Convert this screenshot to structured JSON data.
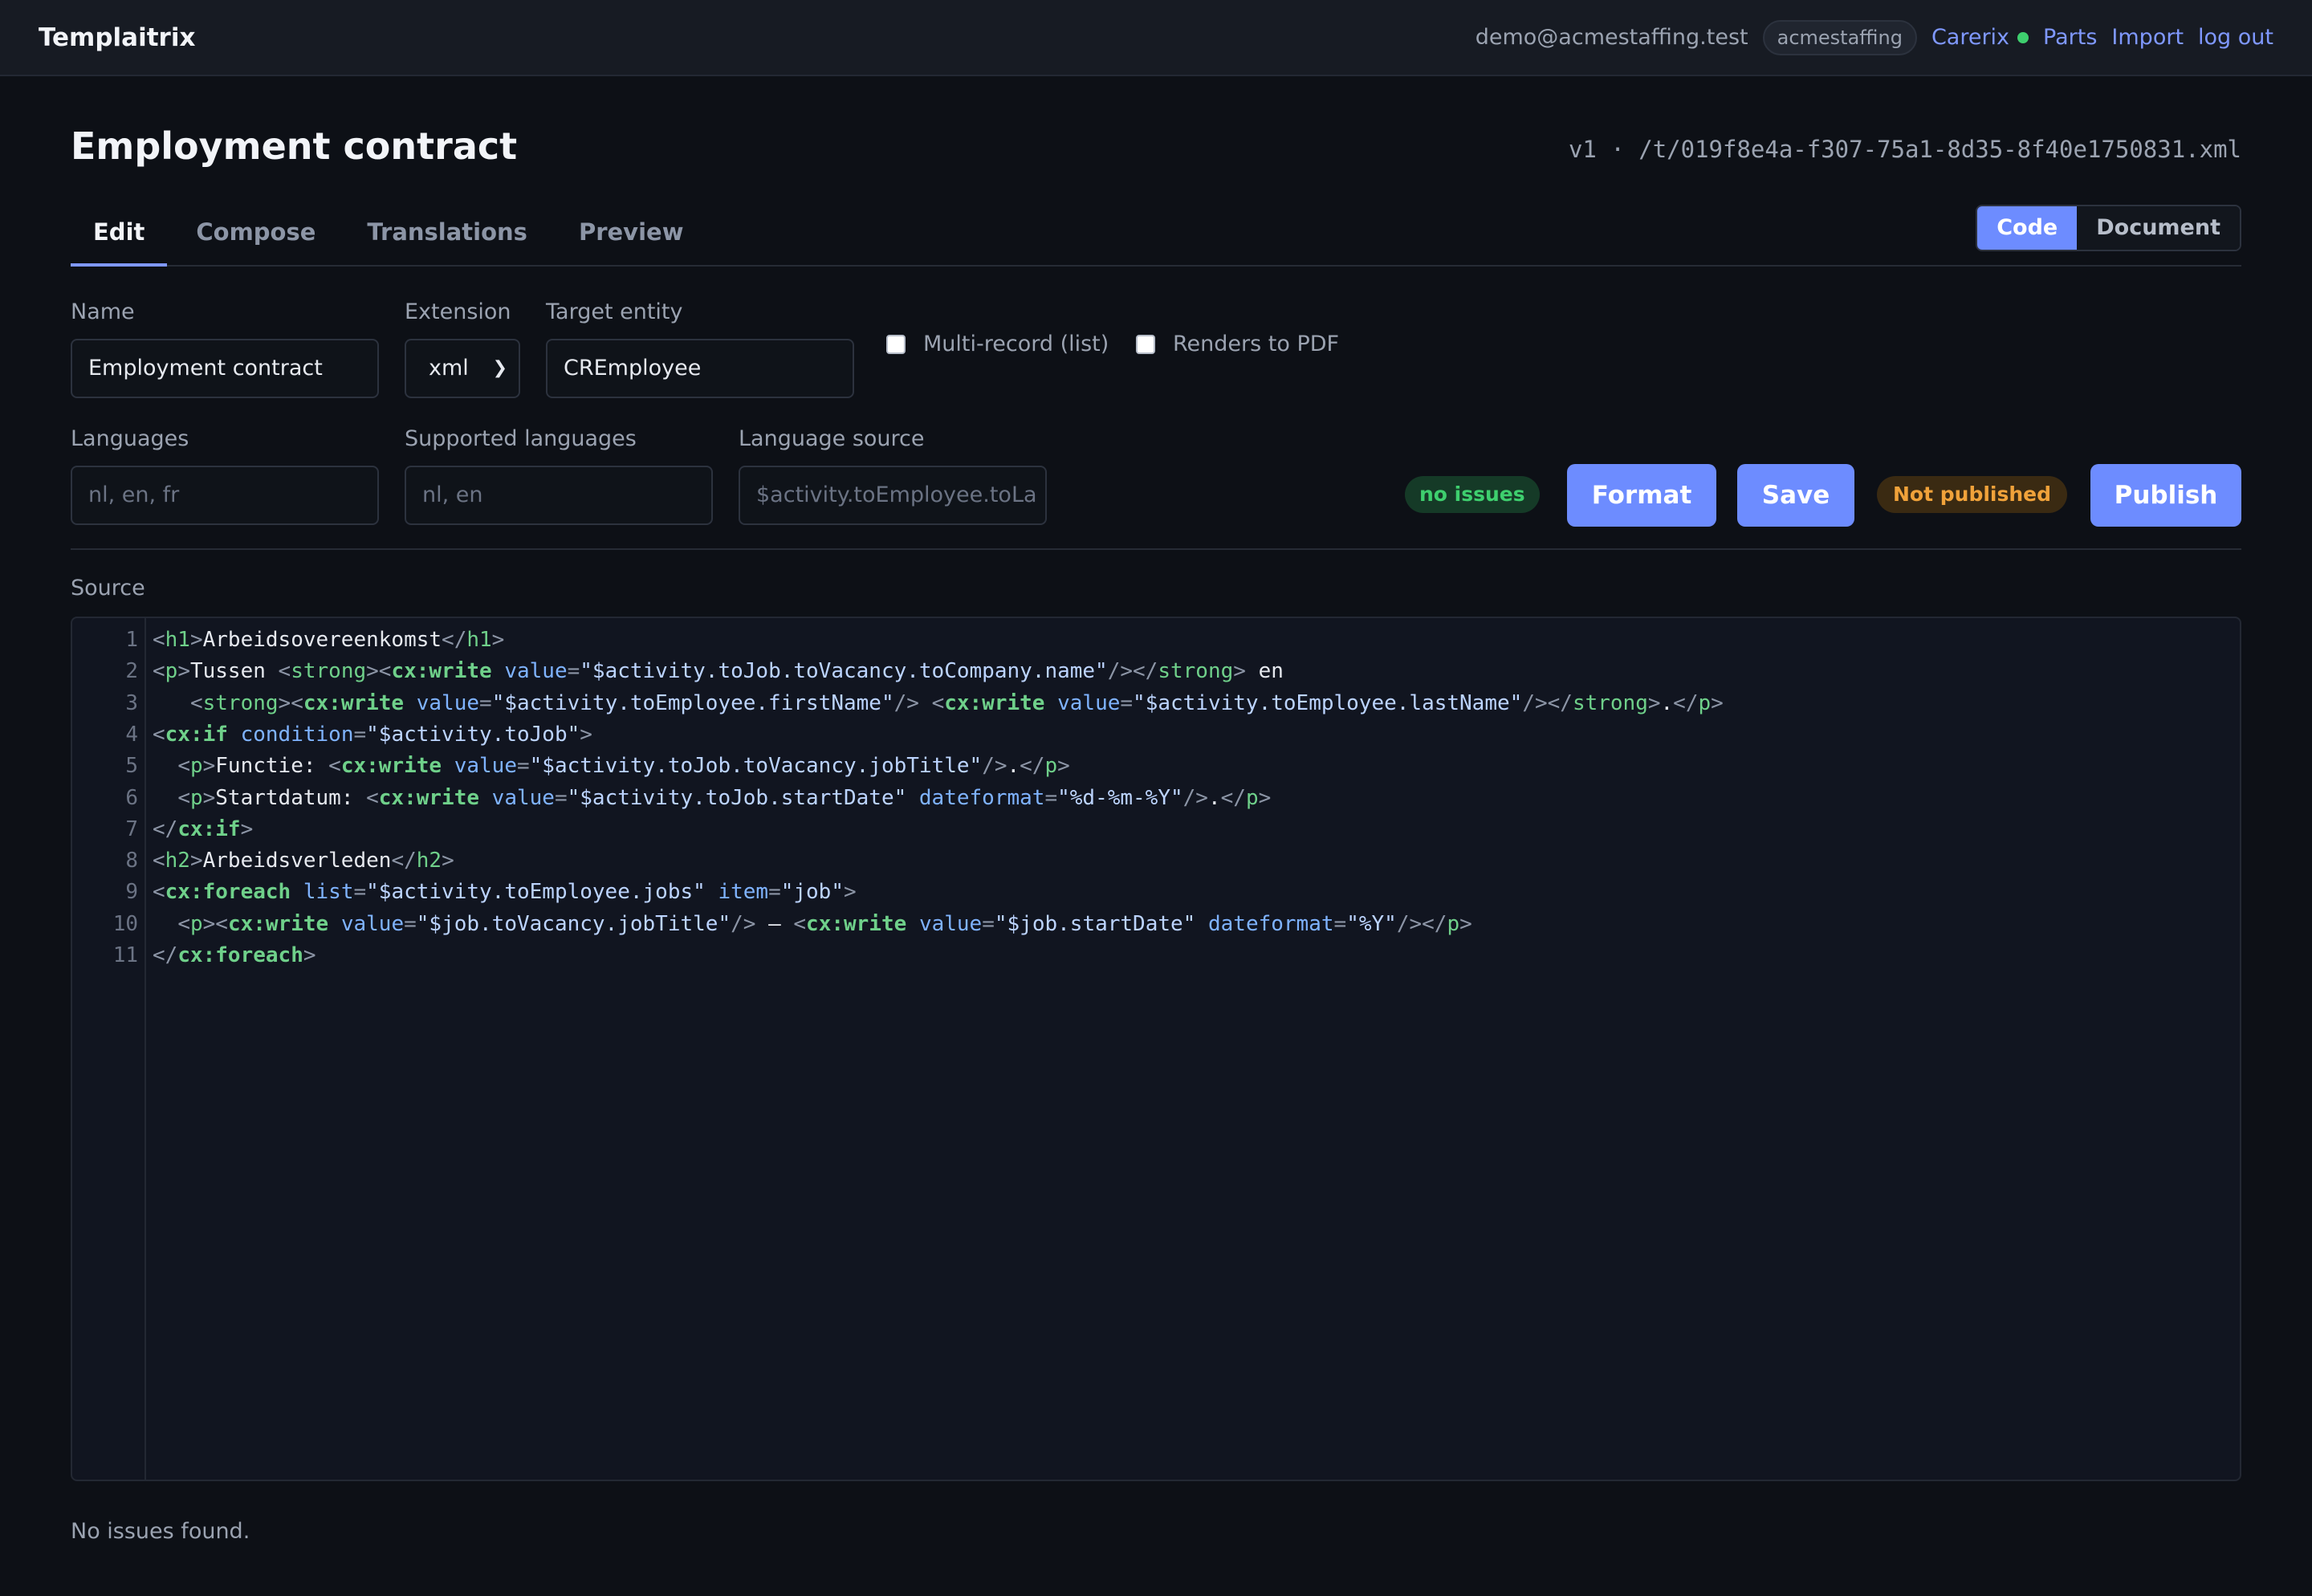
{
  "app": {
    "brand": "Templaitrix",
    "user_email": "demo@acmestaffing.test",
    "org": "acmestaffing",
    "nav": {
      "carerix": "Carerix",
      "parts": "Parts",
      "import": "Import",
      "logout": "log out"
    },
    "carerix_status_color": "#3ecf6e"
  },
  "page": {
    "title": "Employment contract",
    "meta": "v1 · /t/019f8e4a-f307-75a1-8d35-8f40e1750831.xml"
  },
  "tabs": [
    "Edit",
    "Compose",
    "Translations",
    "Preview"
  ],
  "active_tab": "Edit",
  "view_toggle": {
    "code": "Code",
    "document": "Document",
    "active": "Code"
  },
  "form": {
    "name": {
      "label": "Name",
      "value": "Employment contract"
    },
    "extension": {
      "label": "Extension",
      "value": "xml"
    },
    "target_entity": {
      "label": "Target entity",
      "value": "CREmployee"
    },
    "multi_record": {
      "label": "Multi-record (list)",
      "checked": false
    },
    "renders_pdf": {
      "label": "Renders to PDF",
      "checked": false
    },
    "languages": {
      "label": "Languages",
      "placeholder": "nl, en, fr"
    },
    "supported_languages": {
      "label": "Supported languages",
      "placeholder": "nl, en"
    },
    "language_source": {
      "label": "Language source",
      "placeholder": "$activity.toEmployee.toLa"
    }
  },
  "actions": {
    "issues_badge": "no issues",
    "format": "Format",
    "save": "Save",
    "publish_status": "Not published",
    "publish": "Publish"
  },
  "source": {
    "label": "Source",
    "lines": [
      [
        [
          "br",
          "<"
        ],
        [
          "tag",
          "h1"
        ],
        [
          "br",
          ">"
        ],
        [
          "txt",
          "Arbeidsovereenkomst"
        ],
        [
          "br",
          "</"
        ],
        [
          "tag",
          "h1"
        ],
        [
          "br",
          ">"
        ]
      ],
      [
        [
          "br",
          "<"
        ],
        [
          "tag",
          "p"
        ],
        [
          "br",
          ">"
        ],
        [
          "txt",
          "Tussen "
        ],
        [
          "br",
          "<"
        ],
        [
          "tag",
          "strong"
        ],
        [
          "br",
          "><"
        ],
        [
          "cx",
          "cx:write"
        ],
        [
          "txt",
          " "
        ],
        [
          "attr",
          "value"
        ],
        [
          "br",
          "="
        ],
        [
          "str",
          "\"$activity.toJob.toVacancy.toCompany.name\""
        ],
        [
          "br",
          "/></"
        ],
        [
          "tag",
          "strong"
        ],
        [
          "br",
          ">"
        ],
        [
          "txt",
          " en"
        ]
      ],
      [
        [
          "txt",
          "   "
        ],
        [
          "br",
          "<"
        ],
        [
          "tag",
          "strong"
        ],
        [
          "br",
          "><"
        ],
        [
          "cx",
          "cx:write"
        ],
        [
          "txt",
          " "
        ],
        [
          "attr",
          "value"
        ],
        [
          "br",
          "="
        ],
        [
          "str",
          "\"$activity.toEmployee.firstName\""
        ],
        [
          "br",
          "/>"
        ],
        [
          "txt",
          " "
        ],
        [
          "br",
          "<"
        ],
        [
          "cx",
          "cx:write"
        ],
        [
          "txt",
          " "
        ],
        [
          "attr",
          "value"
        ],
        [
          "br",
          "="
        ],
        [
          "str",
          "\"$activity.toEmployee.lastName\""
        ],
        [
          "br",
          "/></"
        ],
        [
          "tag",
          "strong"
        ],
        [
          "br",
          ">"
        ],
        [
          "txt",
          "."
        ],
        [
          "br",
          "</"
        ],
        [
          "tag",
          "p"
        ],
        [
          "br",
          ">"
        ]
      ],
      [
        [
          "br",
          "<"
        ],
        [
          "cx",
          "cx:if"
        ],
        [
          "txt",
          " "
        ],
        [
          "attr",
          "condition"
        ],
        [
          "br",
          "="
        ],
        [
          "str",
          "\"$activity.toJob\""
        ],
        [
          "br",
          ">"
        ]
      ],
      [
        [
          "txt",
          "  "
        ],
        [
          "br",
          "<"
        ],
        [
          "tag",
          "p"
        ],
        [
          "br",
          ">"
        ],
        [
          "txt",
          "Functie: "
        ],
        [
          "br",
          "<"
        ],
        [
          "cx",
          "cx:write"
        ],
        [
          "txt",
          " "
        ],
        [
          "attr",
          "value"
        ],
        [
          "br",
          "="
        ],
        [
          "str",
          "\"$activity.toJob.toVacancy.jobTitle\""
        ],
        [
          "br",
          "/>"
        ],
        [
          "txt",
          "."
        ],
        [
          "br",
          "</"
        ],
        [
          "tag",
          "p"
        ],
        [
          "br",
          ">"
        ]
      ],
      [
        [
          "txt",
          "  "
        ],
        [
          "br",
          "<"
        ],
        [
          "tag",
          "p"
        ],
        [
          "br",
          ">"
        ],
        [
          "txt",
          "Startdatum: "
        ],
        [
          "br",
          "<"
        ],
        [
          "cx",
          "cx:write"
        ],
        [
          "txt",
          " "
        ],
        [
          "attr",
          "value"
        ],
        [
          "br",
          "="
        ],
        [
          "str",
          "\"$activity.toJob.startDate\""
        ],
        [
          "txt",
          " "
        ],
        [
          "attr",
          "dateformat"
        ],
        [
          "br",
          "="
        ],
        [
          "str",
          "\"%d-%m-%Y\""
        ],
        [
          "br",
          "/>"
        ],
        [
          "txt",
          "."
        ],
        [
          "br",
          "</"
        ],
        [
          "tag",
          "p"
        ],
        [
          "br",
          ">"
        ]
      ],
      [
        [
          "br",
          "</"
        ],
        [
          "cx",
          "cx:if"
        ],
        [
          "br",
          ">"
        ]
      ],
      [
        [
          "br",
          "<"
        ],
        [
          "tag",
          "h2"
        ],
        [
          "br",
          ">"
        ],
        [
          "txt",
          "Arbeidsverleden"
        ],
        [
          "br",
          "</"
        ],
        [
          "tag",
          "h2"
        ],
        [
          "br",
          ">"
        ]
      ],
      [
        [
          "br",
          "<"
        ],
        [
          "cx",
          "cx:foreach"
        ],
        [
          "txt",
          " "
        ],
        [
          "attr",
          "list"
        ],
        [
          "br",
          "="
        ],
        [
          "str",
          "\"$activity.toEmployee.jobs\""
        ],
        [
          "txt",
          " "
        ],
        [
          "attr",
          "item"
        ],
        [
          "br",
          "="
        ],
        [
          "str",
          "\"job\""
        ],
        [
          "br",
          ">"
        ]
      ],
      [
        [
          "txt",
          "  "
        ],
        [
          "br",
          "<"
        ],
        [
          "tag",
          "p"
        ],
        [
          "br",
          "><"
        ],
        [
          "cx",
          "cx:write"
        ],
        [
          "txt",
          " "
        ],
        [
          "attr",
          "value"
        ],
        [
          "br",
          "="
        ],
        [
          "str",
          "\"$job.toVacancy.jobTitle\""
        ],
        [
          "br",
          "/>"
        ],
        [
          "txt",
          " – "
        ],
        [
          "br",
          "<"
        ],
        [
          "cx",
          "cx:write"
        ],
        [
          "txt",
          " "
        ],
        [
          "attr",
          "value"
        ],
        [
          "br",
          "="
        ],
        [
          "str",
          "\"$job.startDate\""
        ],
        [
          "txt",
          " "
        ],
        [
          "attr",
          "dateformat"
        ],
        [
          "br",
          "="
        ],
        [
          "str",
          "\"%Y\""
        ],
        [
          "br",
          "/></"
        ],
        [
          "tag",
          "p"
        ],
        [
          "br",
          ">"
        ]
      ],
      [
        [
          "br",
          "</"
        ],
        [
          "cx",
          "cx:foreach"
        ],
        [
          "br",
          ">"
        ]
      ]
    ]
  },
  "status_message": "No issues found."
}
